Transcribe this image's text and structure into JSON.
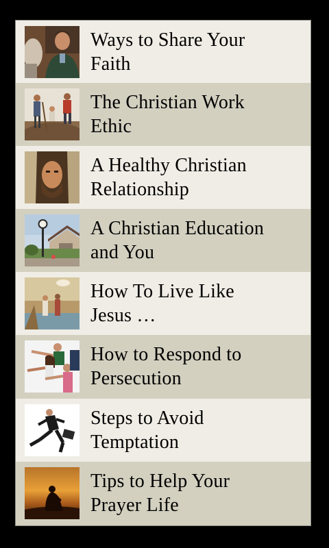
{
  "items": [
    {
      "label": "Ways to Share Your\nFaith",
      "icon": "two-men-talking-photo"
    },
    {
      "label": "The Christian Work\nEthic",
      "icon": "family-gardening-photo"
    },
    {
      "label": "A Healthy Christian\nRelationship",
      "icon": "jesus-portrait-photo"
    },
    {
      "label": "A Christian Education\nand You",
      "icon": "campus-clock-photo"
    },
    {
      "label": "How To Live Like\nJesus …",
      "icon": "baptism-painting-photo"
    },
    {
      "label": "How to Respond to\nPersecution",
      "icon": "people-pointing-photo"
    },
    {
      "label": "Steps to Avoid\nTemptation",
      "icon": "running-businessman-photo"
    },
    {
      "label": "Tips to Help Your\nPrayer Life",
      "icon": "praying-silhouette-photo"
    }
  ],
  "colors": {
    "row_light": "#efede5",
    "row_dark": "#d3d0c0",
    "background": "#000000"
  }
}
